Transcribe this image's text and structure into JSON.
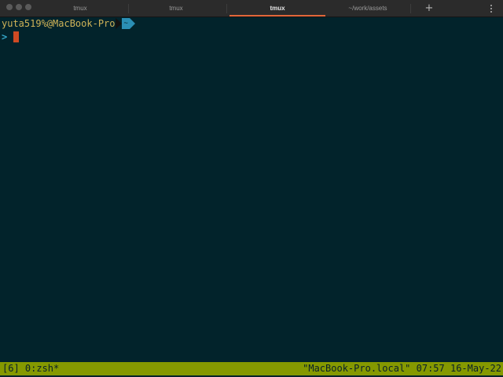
{
  "tabs": [
    {
      "label": "tmux",
      "active": false
    },
    {
      "label": "tmux",
      "active": false
    },
    {
      "label": "tmux",
      "active": true
    },
    {
      "label": "~/work/assets",
      "active": false
    }
  ],
  "tabbar": {
    "new_tab_label": "+",
    "menu_icon": "vertical-ellipsis-icon",
    "accent_color": "#e0663a"
  },
  "terminal": {
    "user_host": "yuta519%@MacBook-Pro",
    "current_dir": "~",
    "prompt_symbol": ">",
    "input_text": "",
    "colors": {
      "background": "#02232b",
      "user_host": "#d0b358",
      "dir_segment": "#2b8fb5",
      "prompt": "#35a7c9",
      "cursor": "#cf4a23"
    }
  },
  "statusbar": {
    "left": "[6] 0:zsh*",
    "right": "\"MacBook-Pro.local\" 07:57 16-May-22",
    "color": "#859900"
  }
}
